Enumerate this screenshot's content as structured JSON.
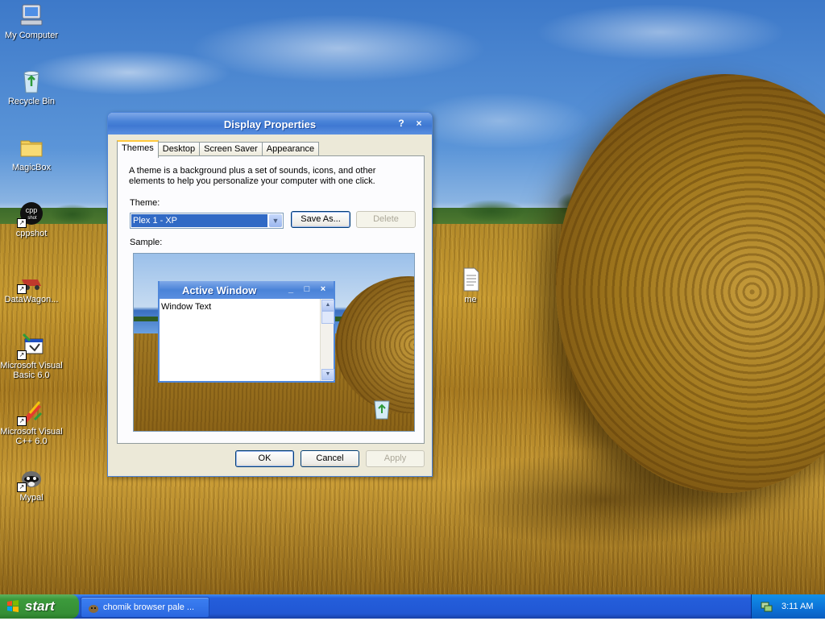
{
  "desktop": {
    "icons": [
      {
        "label": "My Computer",
        "icon": "my-computer-icon"
      },
      {
        "label": "Recycle Bin",
        "icon": "recycle-bin-icon"
      },
      {
        "label": "MagicBox",
        "icon": "folder-icon"
      },
      {
        "label": "cppshot",
        "icon": "cppshot-icon"
      },
      {
        "label": "DataWagon...",
        "icon": "datawagon-icon"
      },
      {
        "label": "Microsoft Visual Basic 6.0",
        "icon": "visual-basic-icon"
      },
      {
        "label": "Microsoft Visual C++ 6.0",
        "icon": "visual-cpp-icon"
      },
      {
        "label": "Mypal",
        "icon": "mypal-icon"
      },
      {
        "label": "me",
        "icon": "text-file-icon"
      }
    ]
  },
  "window": {
    "title": "Display Properties",
    "help_glyph": "?",
    "close_glyph": "×",
    "tabs": [
      {
        "label": "Themes",
        "active": true
      },
      {
        "label": "Desktop",
        "active": false
      },
      {
        "label": "Screen Saver",
        "active": false
      },
      {
        "label": "Appearance",
        "active": false
      }
    ],
    "description": "A theme is a background plus a set of sounds, icons, and other elements to help you personalize your computer with one click.",
    "theme_label": "Theme:",
    "theme_value": "Plex 1 - XP",
    "save_as": "Save As...",
    "delete": "Delete",
    "sample_label": "Sample:",
    "preview": {
      "title": "Active Window",
      "window_text": "Window Text"
    },
    "ok": "OK",
    "cancel": "Cancel",
    "apply": "Apply"
  },
  "taskbar": {
    "start": "start",
    "task": "chomik browser pale ...",
    "clock": "3:11 AM"
  },
  "colors": {
    "titlebar": "#4a83d8",
    "taskbar": "#245edb",
    "start_button": "#3c9a3c",
    "selection": "#316ac5"
  }
}
